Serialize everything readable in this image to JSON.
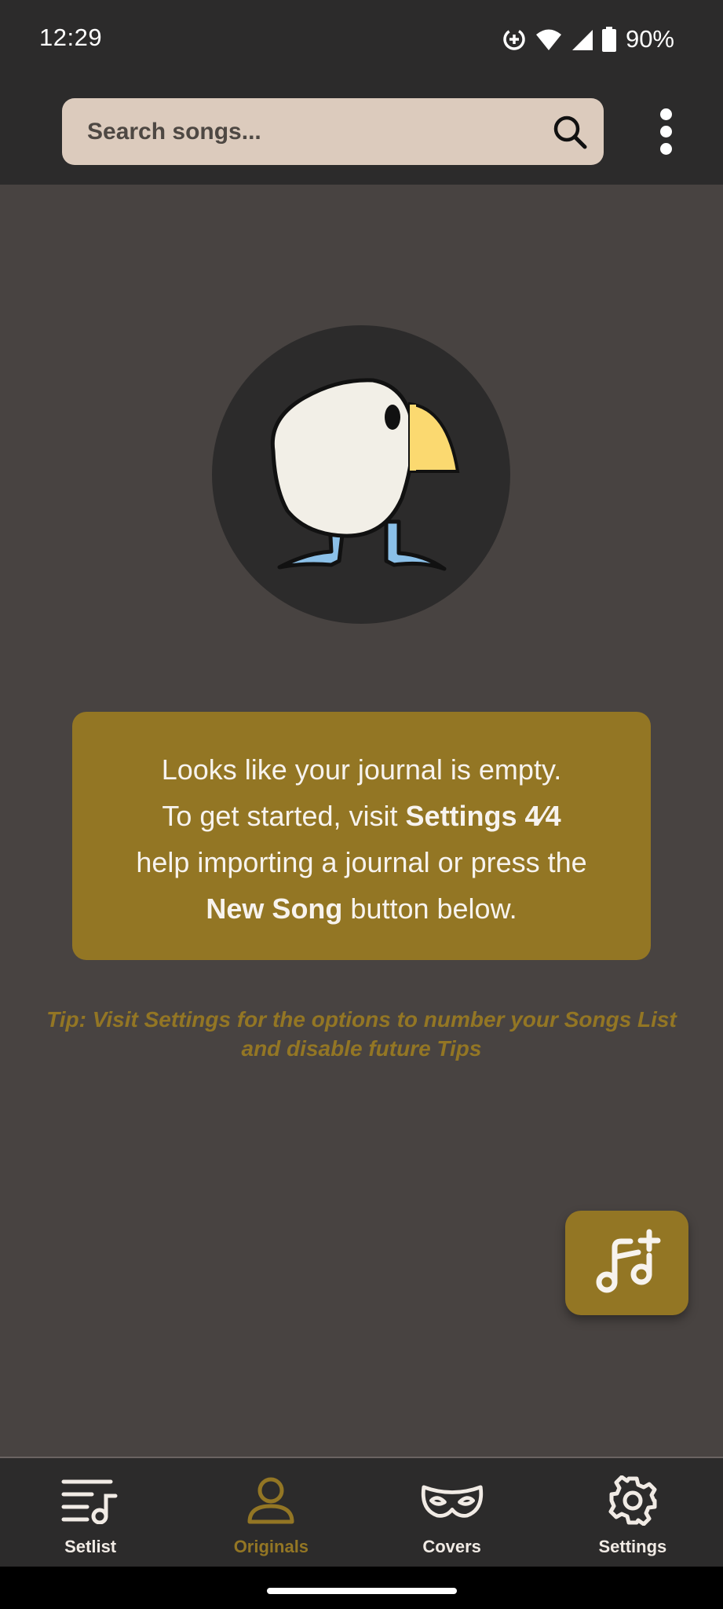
{
  "status_bar": {
    "time": "12:29",
    "battery_percent": "90%",
    "icons": [
      "data-saver-icon",
      "wifi-icon",
      "cellular-signal-icon",
      "battery-icon"
    ]
  },
  "app_bar": {
    "search_placeholder": "Search songs...",
    "search_value": "",
    "search_icon": "search-icon",
    "overflow_icon": "more-vert-icon"
  },
  "empty_state": {
    "mascot_icon": "bird-mascot-icon",
    "line1": "Looks like your journal is empty.",
    "line2_pre": "To get started, visit ",
    "line2_bold": "Settings 4⁄4",
    "line3": "help importing a journal or press the",
    "line4_bold": "New Song",
    "line4_post": " button below.",
    "tip": "Tip: Visit Settings for the options to number your Songs List and disable future Tips"
  },
  "fab": {
    "icon": "add-song-icon"
  },
  "bottom_nav": {
    "active_tab": "Originals",
    "items": [
      {
        "label": "Setlist",
        "icon": "setlist-icon"
      },
      {
        "label": "Originals",
        "icon": "person-icon"
      },
      {
        "label": "Covers",
        "icon": "mask-icon"
      },
      {
        "label": "Settings",
        "icon": "gear-icon"
      }
    ]
  },
  "colors": {
    "accent": "#937624",
    "background": "#484341",
    "bars": "#2c2b2b",
    "search_field": "#dccbbd",
    "text_light": "#f7f3ee"
  }
}
